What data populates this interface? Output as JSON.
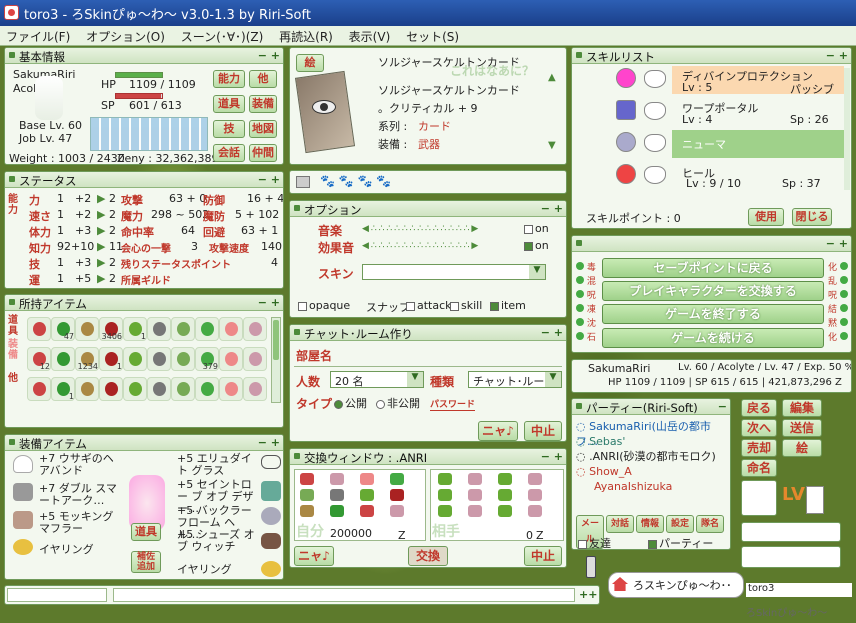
{
  "window": {
    "title": "toro3 - ろSkinぴゅ～わ～ v3.0-1.3 by Riri-Soft"
  },
  "menu": [
    "ファイル(F)",
    "オプション(O)",
    "スーン(･∀･)(Z)",
    "再読込(R)",
    "表示(V)",
    "セット(S)"
  ],
  "basic": {
    "title": "基本情報",
    "name": "SakumaRiri",
    "job": "Acolyte",
    "hp_label": "HP",
    "hp": "1109 / 1109",
    "sp_label": "SP",
    "sp": "601 / 613",
    "base": "Base Lv. 60",
    "joblv": "Job Lv. 47",
    "weight": "Weight : 1003 / 2430",
    "zeny": "Zeny : 32,362,389",
    "hp_fill": 1.0,
    "sp_fill": 0.98,
    "buttons": [
      "能力",
      "他",
      "道具",
      "装備",
      "技",
      "地図",
      "会話",
      "仲間"
    ]
  },
  "card": {
    "tab": "絵",
    "name_top": "ソルジャースケルトンカード",
    "name": "ソルジャースケルトンカード",
    "effect": "。クリティカル + 9",
    "kind_label": "系列 :",
    "kind": "カード",
    "equip_label": "装備 :",
    "equip": "武器",
    "watermark": "これはなあに？"
  },
  "status": {
    "title": "ステータス",
    "side": "能力",
    "stats": [
      {
        "n": "力",
        "v": "1",
        "b": "+2",
        "p": "2"
      },
      {
        "n": "速さ",
        "v": "1",
        "b": "+2",
        "p": "2"
      },
      {
        "n": "体力",
        "v": "1",
        "b": "+3",
        "p": "2"
      },
      {
        "n": "知力",
        "v": "92+10",
        "b": "",
        "p": "11"
      },
      {
        "n": "技",
        "v": "1",
        "b": "+3",
        "p": "2"
      },
      {
        "n": "運",
        "v": "1",
        "b": "+5",
        "p": "2"
      }
    ],
    "sub": [
      {
        "n": "攻撃",
        "v": "63 + 0"
      },
      {
        "n": "魔力",
        "v": "298 ~ 502"
      },
      {
        "n": "命中率",
        "v": "64"
      },
      {
        "n": "会心の一撃",
        "v": "3"
      },
      {
        "n": "残りステータスポイント",
        "v": "4"
      },
      {
        "n": "所属ギルド",
        "v": ""
      }
    ],
    "sub2": [
      {
        "n": "防御",
        "v": "16 + 4"
      },
      {
        "n": "魔防",
        "v": "5 + 102"
      },
      {
        "n": "回避",
        "v": "63 + 1"
      },
      {
        "n": "攻撃速度",
        "v": "140"
      }
    ]
  },
  "items": {
    "title": "所持アイテム",
    "tabs": [
      "道具",
      "装備",
      "他"
    ],
    "counts": [
      "",
      "47",
      "",
      "3406",
      "1",
      "",
      "",
      "",
      "",
      "",
      "12",
      "",
      "1234",
      "1",
      "",
      "",
      "",
      "379",
      "",
      "",
      "",
      "1",
      "",
      "",
      "",
      "",
      "",
      "",
      "",
      "",
      ""
    ]
  },
  "equip": {
    "title": "装備アイテム",
    "left": [
      "+7 ウサギのヘアバンド",
      "+7 ダブル スマートアーク…",
      "+5 モッキング マフラー",
      "イヤリング"
    ],
    "right": [
      "+5 エリュダイト グラス",
      "+5 セイントロー ブ オブ デザー…",
      "+5 バックラー フローム ヘル…",
      "+5 シューズ オブ ウィッチ",
      "イヤリング"
    ],
    "btn_items": "道具",
    "btn_rep": "補佐 追加"
  },
  "cardbar": {
    "paws": "🐾 🐾 🐾 🐾"
  },
  "option": {
    "title": "オプション",
    "music": "音楽",
    "se": "効果音",
    "skin": "スキン",
    "on": "on",
    "on2": "on",
    "checks": [
      "opaque",
      "スナップ",
      "attack",
      "skill",
      "item"
    ]
  },
  "chat": {
    "title": "チャット･ルーム作り",
    "room": "部屋名",
    "ppl_label": "人数",
    "ppl": "20 名",
    "kind_label": "種類",
    "kind": "チャット･ルー",
    "type_label": "タイプ",
    "public": "公開",
    "private": "非公開",
    "pw": "パスワード",
    "btn_nya": "ニャ♪",
    "btn_stop": "中止"
  },
  "trade": {
    "title": "交換ウィンドウ : .ANRI",
    "self": "自分",
    "other": "相手",
    "zeny_self": "200000",
    "z": "Z",
    "zeny_other": "0",
    "btn_nya": "ニャ♪",
    "btn_trade": "交換",
    "btn_stop": "中止"
  },
  "skills": {
    "title": "スキルリスト",
    "list": [
      {
        "name": "ディバインプロテクション",
        "lv": "Lv : 5",
        "sp": "パッシブ"
      },
      {
        "name": "ワープポータル",
        "lv": "Lv : 4",
        "sp": "Sp : 26"
      },
      {
        "name": "ニューマ",
        "lv": "",
        "sp": ""
      },
      {
        "name": "ヒール",
        "lv": "Lv : 9 / 10",
        "sp": "Sp : 37"
      }
    ],
    "points": "スキルポイント : 0",
    "use": "使用",
    "close": "閉じる"
  },
  "menu_btns": [
    "セーブポイントに戻る",
    "プレイキャラクターを交換する",
    "ゲームを終了する",
    "ゲームを続ける"
  ],
  "side_left": [
    "毒",
    "混",
    "呪",
    "凍",
    "沈",
    "石"
  ],
  "side_right": [
    "化",
    "乱",
    "呪",
    "結",
    "黙",
    "化"
  ],
  "charinfo": {
    "name": "SakumaRiri",
    "lv": "Lv. 60 / Acolyte / Lv. 47 / Exp. 50 %",
    "hp": "HP 1109 / 1109 | SP 615 / 615 | 421,873,296 Z"
  },
  "party": {
    "title": "パーティー(Riri-Soft)",
    "members": [
      "SakumaRiri(山岳の都市フ…",
      "Sebas'",
      ".ANRI(砂漠の都市モロク)",
      "Show_A",
      "AyanaIshizuka"
    ],
    "tabs": [
      "メール",
      "対話",
      "情報",
      "設定",
      "隊名"
    ],
    "friend": "友達",
    "pt": "パーティー"
  },
  "rightbtns": [
    "戻る",
    "編集",
    "次へ",
    "送信",
    "売却",
    "絵",
    "命名"
  ],
  "lv": "LV",
  "chatbar": {
    "bubble": "ろスキンぴゅ～わ･･",
    "toro": "toro3",
    "skin": "ろSkinぴゅ～わ～"
  },
  "colors": {
    "accent": "#c0382b",
    "panel": "#f3f8ef",
    "border": "#6f9a5a"
  }
}
